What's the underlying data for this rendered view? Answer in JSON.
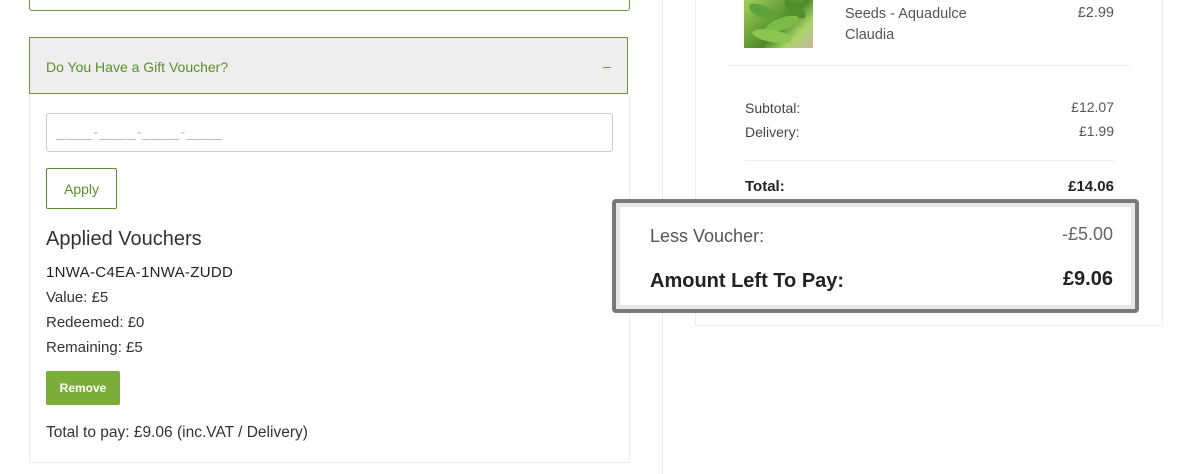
{
  "voucher": {
    "header_title": "Do You Have a Gift Voucher?",
    "toggle_symbol": "–",
    "input_placeholder": "____-____-____-____",
    "apply_label": "Apply",
    "applied_heading": "Applied Vouchers",
    "applied": {
      "code": "1NWA-C4EA-1NWA-ZUDD",
      "value": "Value: £5",
      "redeemed": "Redeemed: £0",
      "remaining": "Remaining: £5",
      "remove_label": "Remove"
    },
    "total_to_pay": "Total to pay: £9.06 (inc.VAT / Delivery)"
  },
  "summary": {
    "product": {
      "name_line1": "Seeds - Aquadulce",
      "name_line2": "Claudia",
      "price": "£2.99",
      "image_icon": "broad-bean-product-image"
    },
    "subtotal_label": "Subtotal:",
    "subtotal_value": "£12.07",
    "delivery_label": "Delivery:",
    "delivery_value": "£1.99",
    "total_label": "Total:",
    "total_value": "£14.06",
    "less_voucher_label": "Less Voucher:",
    "less_voucher_value": "-£5.00",
    "amount_left_label": "Amount Left To Pay:",
    "amount_left_value": "£9.06"
  },
  "colors": {
    "brand_green": "#5a8f2b",
    "button_green": "#7cad3a",
    "highlight_border": "#7a7a7a"
  }
}
